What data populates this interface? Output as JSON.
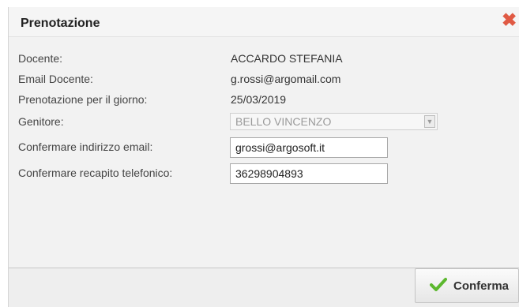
{
  "dialog": {
    "title": "Prenotazione",
    "close_icon": "close-icon"
  },
  "fields": {
    "docente_label": "Docente:",
    "docente_value": "ACCARDO STEFANIA",
    "email_docente_label": "Email Docente:",
    "email_docente_value": "g.rossi@argomail.com",
    "giorno_label": "Prenotazione per il giorno:",
    "giorno_value": "25/03/2019",
    "genitore_label": "Genitore:",
    "genitore_value": "BELLO VINCENZO",
    "conferma_email_label": "Confermare indirizzo email:",
    "conferma_email_value": "grossi@argosoft.it",
    "conferma_tel_label": "Confermare recapito telefonico:",
    "conferma_tel_value": "36298904893"
  },
  "footer": {
    "confirm_label": "Conferma",
    "confirm_icon": "check-icon"
  },
  "colors": {
    "close": "#e05a44",
    "check": "#5cb82e",
    "background": "#f0f0f0"
  }
}
